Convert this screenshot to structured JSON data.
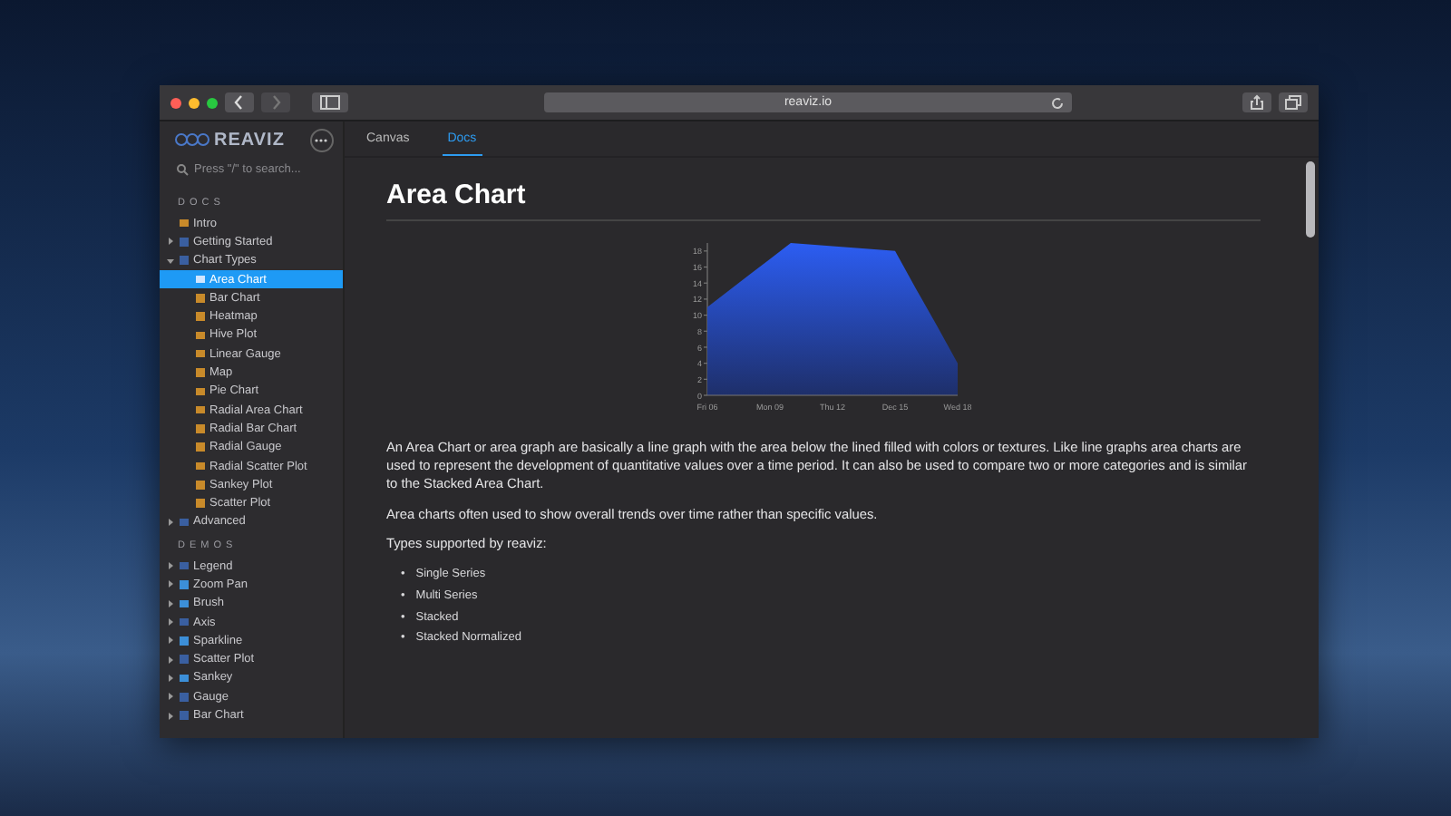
{
  "browser": {
    "url": "reaviz.io"
  },
  "header": {
    "logo": "REAVIZ",
    "tabs": [
      {
        "label": "Canvas",
        "selected": false
      },
      {
        "label": "Docs",
        "selected": true
      }
    ]
  },
  "sidebar": {
    "search": {
      "placeholder": "Press \"/\" to search..."
    },
    "sections": [
      {
        "title": "DOCS",
        "items": [
          {
            "label": "Intro",
            "kind": "page",
            "selected": false
          },
          {
            "label": "Getting Started",
            "kind": "folder",
            "expanded": false,
            "selected": false
          },
          {
            "label": "Chart Types",
            "kind": "folder",
            "expanded": true,
            "selected": false,
            "children": [
              {
                "label": "Area Chart",
                "kind": "page",
                "selected": true
              },
              {
                "label": "Bar Chart",
                "kind": "page",
                "selected": false
              },
              {
                "label": "Heatmap",
                "kind": "page",
                "selected": false
              },
              {
                "label": "Hive Plot",
                "kind": "page",
                "selected": false
              },
              {
                "label": "Linear Gauge",
                "kind": "page",
                "selected": false
              },
              {
                "label": "Map",
                "kind": "page",
                "selected": false
              },
              {
                "label": "Pie Chart",
                "kind": "page",
                "selected": false
              },
              {
                "label": "Radial Area Chart",
                "kind": "page",
                "selected": false
              },
              {
                "label": "Radial Bar Chart",
                "kind": "page",
                "selected": false
              },
              {
                "label": "Radial Gauge",
                "kind": "page",
                "selected": false
              },
              {
                "label": "Radial Scatter Plot",
                "kind": "page",
                "selected": false
              },
              {
                "label": "Sankey Plot",
                "kind": "page",
                "selected": false
              },
              {
                "label": "Scatter Plot",
                "kind": "page",
                "selected": false
              }
            ]
          },
          {
            "label": "Advanced",
            "kind": "folder",
            "expanded": false,
            "selected": false
          }
        ]
      },
      {
        "title": "DEMOS",
        "items": [
          {
            "label": "Legend",
            "kind": "folder",
            "expanded": false,
            "selected": false
          },
          {
            "label": "Zoom Pan",
            "kind": "demo",
            "expanded": false,
            "selected": false
          },
          {
            "label": "Brush",
            "kind": "demo",
            "expanded": false,
            "selected": false
          },
          {
            "label": "Axis",
            "kind": "folder",
            "expanded": false,
            "selected": false
          },
          {
            "label": "Sparkline",
            "kind": "demo",
            "expanded": false,
            "selected": false
          },
          {
            "label": "Scatter Plot",
            "kind": "folder",
            "expanded": false,
            "selected": false
          },
          {
            "label": "Sankey",
            "kind": "demo",
            "expanded": false,
            "selected": false
          },
          {
            "label": "Gauge",
            "kind": "folder",
            "expanded": false,
            "selected": false
          },
          {
            "label": "Bar Chart",
            "kind": "folder",
            "expanded": false,
            "selected": false
          }
        ]
      }
    ]
  },
  "content": {
    "title": "Area Chart",
    "chart_data": {
      "type": "area",
      "categories": [
        "Fri 06",
        null,
        null,
        "Mon 09",
        null,
        null,
        "Thu 12",
        null,
        null,
        "Dec 15",
        null,
        null,
        "Wed 18"
      ],
      "series": [
        {
          "color": "#2c5df2",
          "values": [
            11,
            13,
            15,
            17,
            19,
            18.8,
            18.6,
            18.4,
            18.2,
            18,
            13.3,
            8.7,
            4
          ]
        }
      ],
      "ylim": [
        0,
        19
      ],
      "yticks": [
        0,
        2,
        4,
        6,
        8,
        10,
        12,
        14,
        16,
        18
      ]
    },
    "paragraphs": [
      "An Area Chart or area graph are basically a line graph with the area below the lined filled with colors or textures. Like line graphs area charts are used to represent the development of quantitative values over a time period. It can also be used to compare two or more categories and is similar to the Stacked Area Chart.",
      "Area charts often used to show overall trends over time rather than specific values.",
      "Types supported by reaviz:"
    ],
    "list": [
      {
        "bullet": "•",
        "text": "Single Series"
      },
      {
        "bullet": "•",
        "text": "Multi Series"
      },
      {
        "bullet": "•",
        "text": "Stacked"
      },
      {
        "bullet": "•",
        "text": "Stacked Normalized"
      }
    ]
  }
}
